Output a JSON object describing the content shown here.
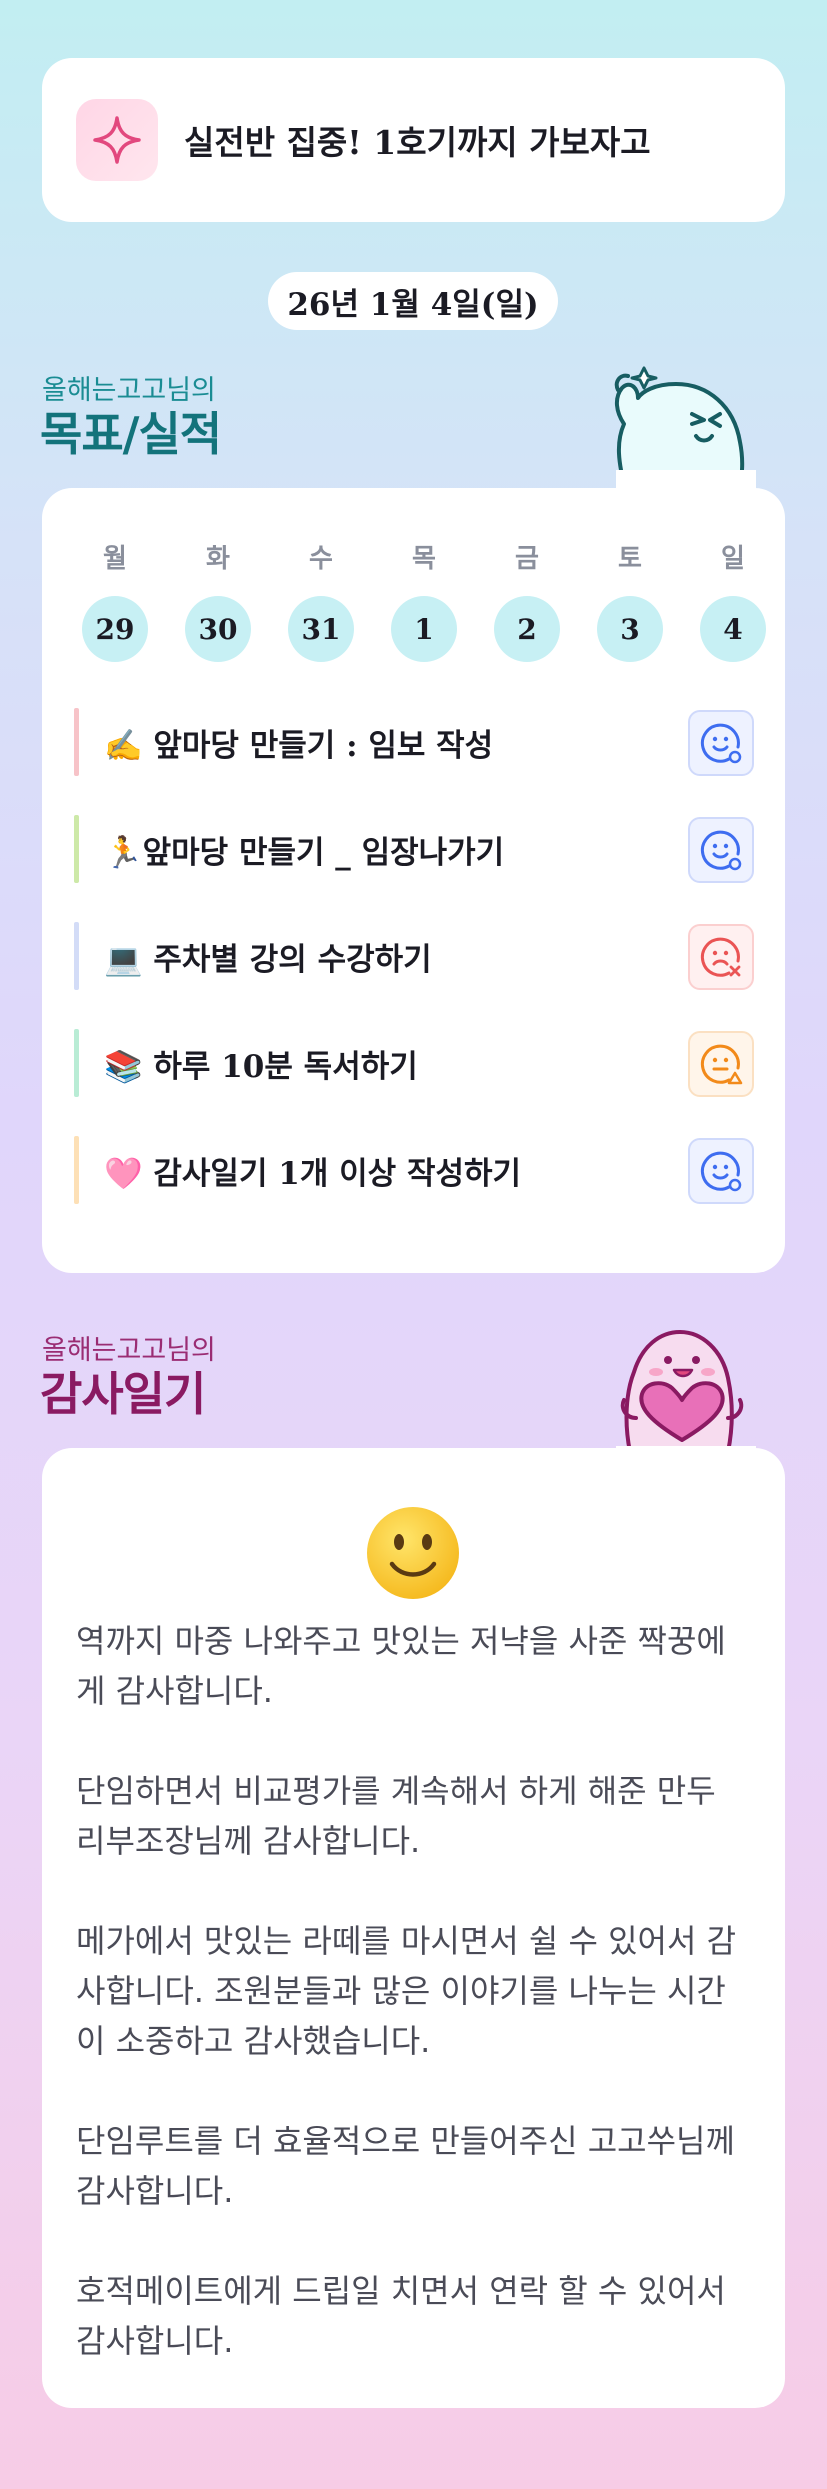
{
  "banner": {
    "icon": "sparkle-icon",
    "text": "실전반 집중! 1호기까지 가보자고"
  },
  "date": "26년 1월 4일(일)",
  "goals_section": {
    "subtitle": "올해는고고님의",
    "title": "목표/실적",
    "mascot": "waving-mascot-icon"
  },
  "week": {
    "days": [
      "월",
      "화",
      "수",
      "목",
      "금",
      "토",
      "일"
    ],
    "dates": [
      "29",
      "30",
      "31",
      "1",
      "2",
      "3",
      "4"
    ]
  },
  "tasks": [
    {
      "text": "✍️ 앞마당 만들기 : 임보 작성",
      "bar_color": "#f7c3c8",
      "status": "smile-check",
      "status_color": "#3e6df0"
    },
    {
      "text": "🏃앞마당 만들기 _ 임장나가기",
      "bar_color": "#cde9a8",
      "status": "smile-check",
      "status_color": "#3e6df0"
    },
    {
      "text": "💻 주차별 강의 수강하기",
      "bar_color": "#d3dcf7",
      "status": "sad-x",
      "status_color": "#ea5454"
    },
    {
      "text": "📚 하루 10분 독서하기",
      "bar_color": "#b9ecd5",
      "status": "neutral-warning",
      "status_color": "#f28a1a"
    },
    {
      "text": "🩷 감사일기 1개 이상 작성하기",
      "bar_color": "#fde0b6",
      "status": "smile-check",
      "status_color": "#3e6df0"
    }
  ],
  "journal_section": {
    "subtitle": "올해는고고님의",
    "title": "감사일기",
    "mascot": "heart-mascot-icon"
  },
  "journal": {
    "mood_icon": "smiley-face-icon",
    "entries": [
      [
        "역까지 마중 나와주고 맛있는 저냑을 사준 짝꿍에",
        "게 감사합니다."
      ],
      [
        "단임하면서 비교평가를 계속해서 하게 해준 만두",
        "리부조장님께 감사합니다."
      ],
      [
        "메가에서 맛있는 라떼를 마시면서 쉴 수 있어서 감",
        "사합니다. 조원분들과 많은 이야기를 나누는 시간",
        "이 소중하고 감사했습니다."
      ],
      [
        "단임루트를 더 효율적으로 만들어주신 고고쑤님께",
        "감사합니다."
      ],
      [
        "호적메이트에게 드립일 치면서 연락 할 수 있어서",
        "감사합니다."
      ]
    ]
  }
}
